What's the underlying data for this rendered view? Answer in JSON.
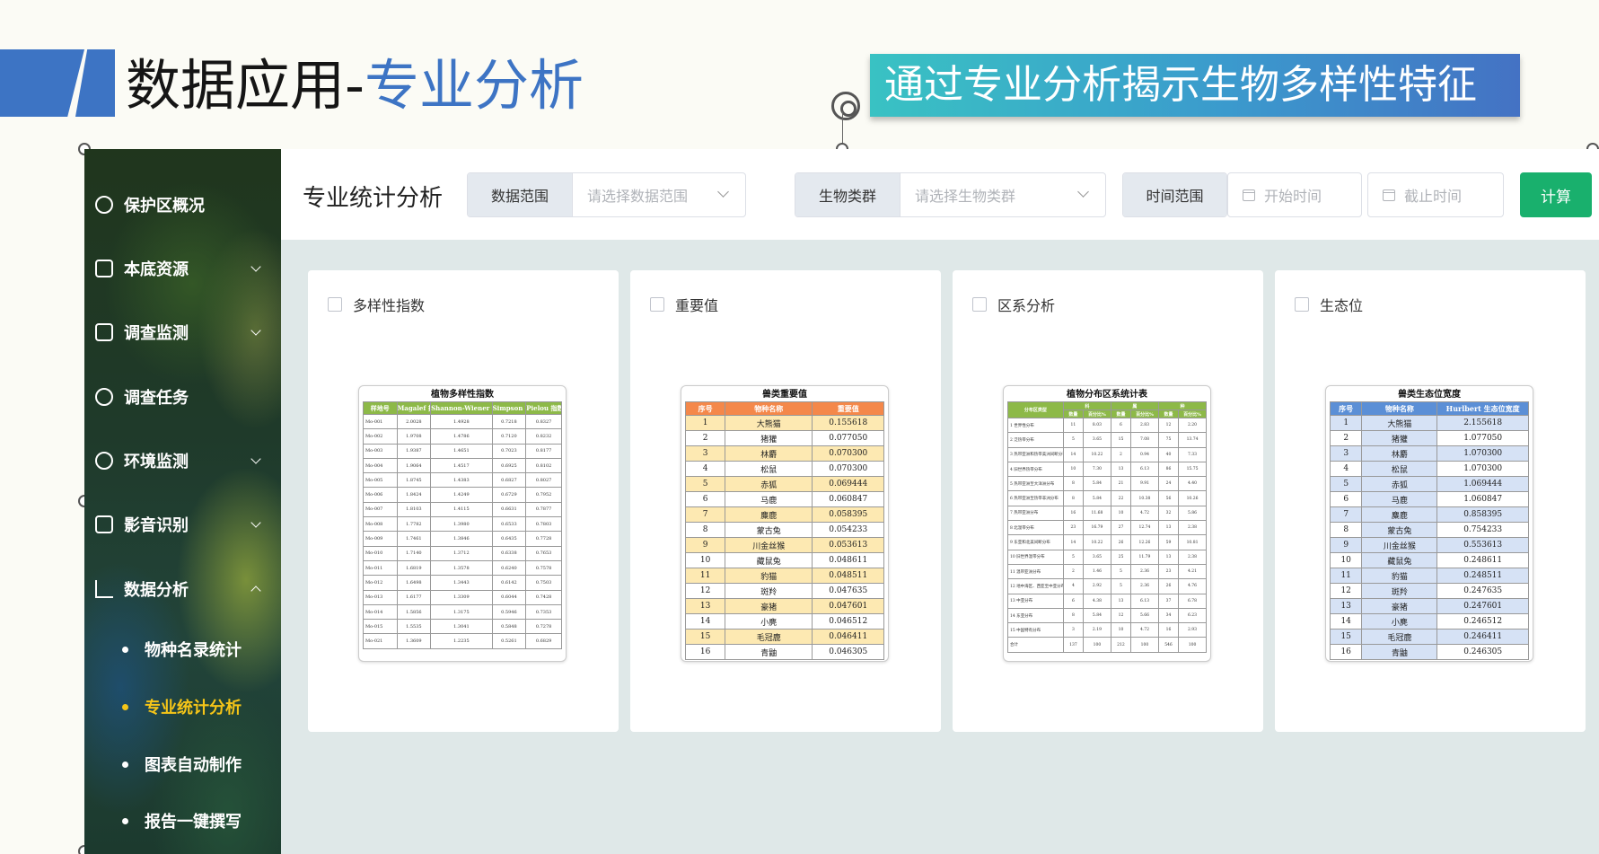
{
  "slide": {
    "title_prefix": "数据应用-",
    "title_highlight": "专业分析",
    "banner": "通过专业分析揭示生物多样性特征"
  },
  "sidebar": {
    "items": [
      {
        "label": "保护区概况",
        "icon": "gauge-icon",
        "expandable": false
      },
      {
        "label": "本底资源",
        "icon": "resource-icon",
        "expandable": true
      },
      {
        "label": "调查监测",
        "icon": "monitor-icon",
        "expandable": true
      },
      {
        "label": "调查任务",
        "icon": "task-icon",
        "expandable": false
      },
      {
        "label": "环境监测",
        "icon": "thermometer-icon",
        "expandable": true
      },
      {
        "label": "影音识别",
        "icon": "camera-icon",
        "expandable": true
      },
      {
        "label": "数据分析",
        "icon": "bar-chart-icon",
        "expandable": true,
        "expanded": true
      }
    ],
    "sub_items": [
      {
        "label": "物种名录统计",
        "active": false
      },
      {
        "label": "专业统计分析",
        "active": true
      },
      {
        "label": "图表自动制作",
        "active": false
      },
      {
        "label": "报告一键撰写",
        "active": false
      }
    ],
    "active_color": "#f5c518"
  },
  "header": {
    "title": "专业统计分析",
    "data_range": {
      "label": "数据范围",
      "placeholder": "请选择数据范围"
    },
    "bio_group": {
      "label": "生物类群",
      "placeholder": "请选择生物类群"
    },
    "time_range": {
      "label": "时间范围",
      "start_placeholder": "开始时间",
      "end_placeholder": "截止时间"
    },
    "calc_button": "计算",
    "accent": "#19b06d"
  },
  "cards": [
    {
      "label": "多样性指数"
    },
    {
      "label": "重要值"
    },
    {
      "label": "区系分析"
    },
    {
      "label": "生态位"
    }
  ],
  "thumbnails": {
    "diversity": {
      "title": "植物多样性指数",
      "headers": [
        "样地号",
        "Magalef 指数",
        "Shannon-Wiener 指数",
        "Simpson 指数",
        "Pielou 指数"
      ],
      "rows": [
        [
          "Mo-001",
          "2.0028",
          "1.4928",
          "0.7218",
          "0.8327"
        ],
        [
          "Mo-002",
          "1.9708",
          "1.4786",
          "0.7120",
          "0.8232"
        ],
        [
          "Mo-003",
          "1.9387",
          "1.4651",
          "0.7023",
          "0.8177"
        ],
        [
          "Mo-004",
          "1.9064",
          "1.4517",
          "0.6925",
          "0.8102"
        ],
        [
          "Mo-005",
          "1.8745",
          "1.4383",
          "0.6827",
          "0.8027"
        ],
        [
          "Mo-006",
          "1.8424",
          "1.4249",
          "0.6729",
          "0.7952"
        ],
        [
          "Mo-007",
          "1.8103",
          "1.4115",
          "0.6631",
          "0.7877"
        ],
        [
          "Mo-008",
          "1.7782",
          "1.3980",
          "0.6533",
          "0.7803"
        ],
        [
          "Mo-009",
          "1.7461",
          "1.3846",
          "0.6435",
          "0.7728"
        ],
        [
          "Mo-010",
          "1.7140",
          "1.3712",
          "0.6338",
          "0.7653"
        ],
        [
          "Mo-011",
          "1.6819",
          "1.3578",
          "0.6240",
          "0.7578"
        ],
        [
          "Mo-012",
          "1.6498",
          "1.3443",
          "0.6142",
          "0.7503"
        ],
        [
          "Mo-013",
          "1.6177",
          "1.3309",
          "0.6044",
          "0.7428"
        ],
        [
          "Mo-014",
          "1.5856",
          "1.3175",
          "0.5946",
          "0.7353"
        ],
        [
          "Mo-015",
          "1.5535",
          "1.3041",
          "0.5848",
          "0.7278"
        ],
        [
          "Mo-021",
          "1.3609",
          "1.2235",
          "0.5261",
          "0.6829"
        ]
      ]
    },
    "importance": {
      "title": "兽类重要值",
      "headers": [
        "序号",
        "物种名称",
        "重要值"
      ],
      "rows": [
        [
          "1",
          "大熊猫",
          "0.155618"
        ],
        [
          "2",
          "猪獾",
          "0.077050"
        ],
        [
          "3",
          "林麝",
          "0.070300"
        ],
        [
          "4",
          "松鼠",
          "0.070300"
        ],
        [
          "5",
          "赤狐",
          "0.069444"
        ],
        [
          "6",
          "马鹿",
          "0.060847"
        ],
        [
          "7",
          "麋鹿",
          "0.058395"
        ],
        [
          "8",
          "蒙古兔",
          "0.054233"
        ],
        [
          "9",
          "川金丝猴",
          "0.053613"
        ],
        [
          "10",
          "藏鼠兔",
          "0.048611"
        ],
        [
          "11",
          "豹猫",
          "0.048511"
        ],
        [
          "12",
          "斑羚",
          "0.047635"
        ],
        [
          "13",
          "豪猪",
          "0.047601"
        ],
        [
          "14",
          "小麂",
          "0.046512"
        ],
        [
          "15",
          "毛冠鹿",
          "0.046411"
        ],
        [
          "16",
          "青鼬",
          "0.046305"
        ]
      ]
    },
    "region": {
      "title": "植物分布区系统计表",
      "group_headers": [
        "科",
        "属",
        "种"
      ],
      "sub_headers": [
        "分布区类型",
        "数量",
        "百分比%",
        "数量",
        "百分比%",
        "数量",
        "百分比%"
      ],
      "rows": [
        [
          "1 世界性分布",
          "11",
          "8.03",
          "6",
          "2.83",
          "12",
          "2.20"
        ],
        [
          "2 泛热带分布",
          "5",
          "3.65",
          "15",
          "7.08",
          "75",
          "13.74"
        ],
        [
          "3 热带亚洲和热带美洲间断分布",
          "14",
          "10.22",
          "2",
          "0.94",
          "40",
          "7.33"
        ],
        [
          "4 旧世界热带分布",
          "10",
          "7.30",
          "13",
          "6.13",
          "86",
          "15.75"
        ],
        [
          "5 热带亚洲至大洋洲分布",
          "8",
          "5.84",
          "21",
          "9.91",
          "24",
          "4.40"
        ],
        [
          "6 热带亚洲至热带非洲分布",
          "8",
          "5.84",
          "22",
          "10.38",
          "56",
          "10.26"
        ],
        [
          "7 热带亚洲分布",
          "16",
          "11.68",
          "10",
          "4.72",
          "32",
          "5.86"
        ],
        [
          "8 北温带分布",
          "23",
          "16.79",
          "27",
          "12.74",
          "13",
          "2.38"
        ],
        [
          "9 东亚和北美间断分布",
          "14",
          "10.22",
          "26",
          "12.26",
          "59",
          "10.81"
        ],
        [
          "10 旧世界温带分布",
          "5",
          "3.65",
          "25",
          "11.79",
          "13",
          "2.38"
        ],
        [
          "11 温带亚洲分布",
          "2",
          "1.46",
          "5",
          "2.36",
          "23",
          "4.21"
        ],
        [
          "12 地中海区、西亚至中亚分布",
          "4",
          "2.92",
          "5",
          "2.36",
          "26",
          "4.76"
        ],
        [
          "13 中亚分布",
          "6",
          "4.38",
          "13",
          "6.13",
          "37",
          "6.78"
        ],
        [
          "14 东亚分布",
          "8",
          "5.84",
          "12",
          "5.66",
          "34",
          "6.23"
        ],
        [
          "15 中国特有分布",
          "3",
          "2.19",
          "10",
          "4.72",
          "16",
          "2.93"
        ],
        [
          "合计",
          "137",
          "100",
          "212",
          "100",
          "546",
          "100"
        ]
      ]
    },
    "niche": {
      "title": "兽类生态位宽度",
      "headers": [
        "序号",
        "物种名称",
        "Hurlbert 生态位宽度"
      ],
      "rows": [
        [
          "1",
          "大熊猫",
          "2.155618"
        ],
        [
          "2",
          "猪獾",
          "1.077050"
        ],
        [
          "3",
          "林麝",
          "1.070300"
        ],
        [
          "4",
          "松鼠",
          "1.070300"
        ],
        [
          "5",
          "赤狐",
          "1.069444"
        ],
        [
          "6",
          "马鹿",
          "1.060847"
        ],
        [
          "7",
          "麋鹿",
          "0.858395"
        ],
        [
          "8",
          "蒙古兔",
          "0.754233"
        ],
        [
          "9",
          "川金丝猴",
          "0.553613"
        ],
        [
          "10",
          "藏鼠兔",
          "0.248611"
        ],
        [
          "11",
          "豹猫",
          "0.248511"
        ],
        [
          "12",
          "斑羚",
          "0.247635"
        ],
        [
          "13",
          "豪猪",
          "0.247601"
        ],
        [
          "14",
          "小麂",
          "0.246512"
        ],
        [
          "15",
          "毛冠鹿",
          "0.246411"
        ],
        [
          "16",
          "青鼬",
          "0.246305"
        ]
      ]
    }
  }
}
